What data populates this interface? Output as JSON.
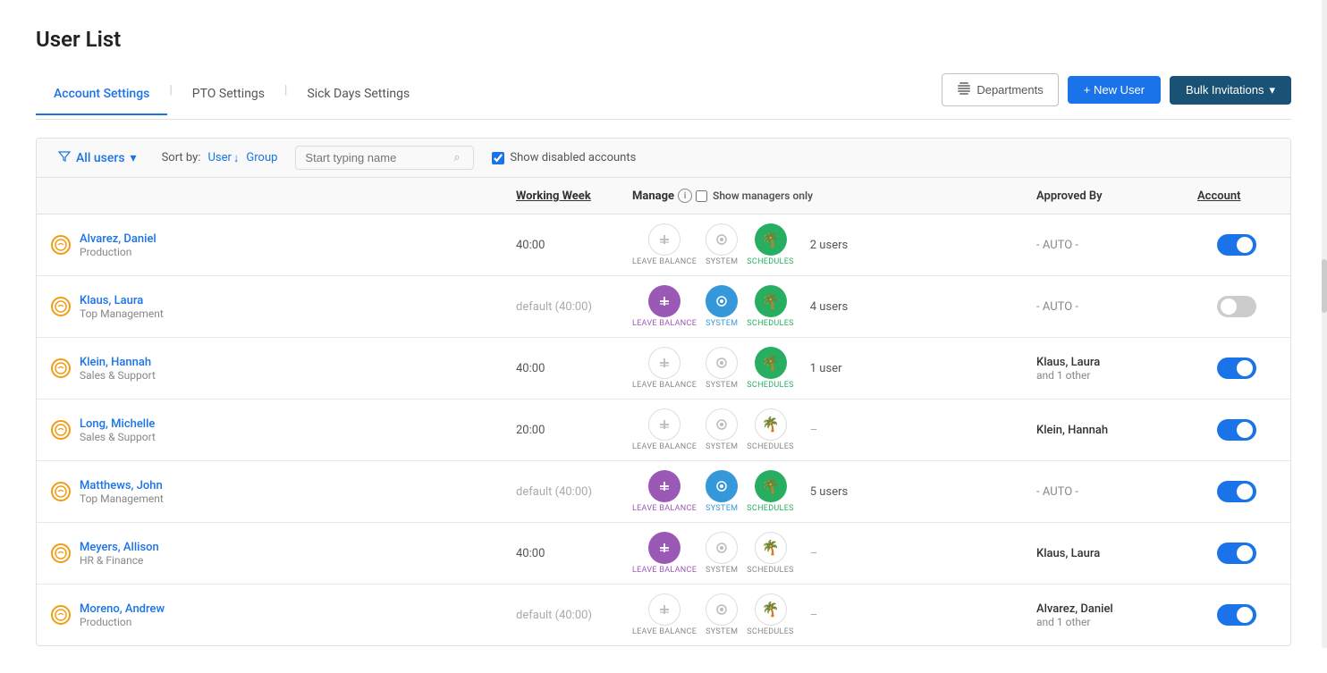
{
  "page": {
    "title": "User List"
  },
  "tabs": [
    {
      "id": "account-settings",
      "label": "Account Settings",
      "active": true
    },
    {
      "id": "pto-settings",
      "label": "PTO Settings",
      "active": false
    },
    {
      "id": "sick-days-settings",
      "label": "Sick Days Settings",
      "active": false
    }
  ],
  "actions": {
    "departments_label": "Departments",
    "new_user_label": "+ New User",
    "bulk_invitations_label": "Bulk Invitations"
  },
  "filter": {
    "all_users_label": "All users",
    "sort_by_label": "Sort by:",
    "sort_user_label": "User",
    "sort_group_label": "Group",
    "search_placeholder": "Start typing name",
    "show_disabled_label": "Show disabled accounts",
    "show_managers_label": "Show managers only"
  },
  "table": {
    "headers": {
      "working_week": "Working Week",
      "manage": "Manage",
      "approved_by": "Approved By",
      "account": "Account"
    },
    "users": [
      {
        "name": "Alvarez, Daniel",
        "department": "Production",
        "working_week": "40:00",
        "working_week_default": false,
        "leave_balance_active": false,
        "system_active": false,
        "schedules_active": true,
        "manage_users": "2 users",
        "approved_by": "- AUTO -",
        "approved_by_sub": "",
        "account_enabled": true
      },
      {
        "name": "Klaus, Laura",
        "department": "Top Management",
        "working_week": "default (40:00)",
        "working_week_default": true,
        "leave_balance_active": true,
        "system_active": true,
        "schedules_active": true,
        "manage_users": "4 users",
        "approved_by": "- AUTO -",
        "approved_by_sub": "",
        "account_enabled": false
      },
      {
        "name": "Klein, Hannah",
        "department": "Sales & Support",
        "working_week": "40:00",
        "working_week_default": false,
        "leave_balance_active": false,
        "system_active": false,
        "schedules_active": true,
        "manage_users": "1 user",
        "approved_by": "Klaus, Laura",
        "approved_by_sub": "and 1 other",
        "account_enabled": true
      },
      {
        "name": "Long, Michelle",
        "department": "Sales & Support",
        "working_week": "20:00",
        "working_week_default": false,
        "leave_balance_active": false,
        "system_active": false,
        "schedules_active": false,
        "manage_users": "–",
        "approved_by": "Klein, Hannah",
        "approved_by_sub": "",
        "account_enabled": true
      },
      {
        "name": "Matthews, John",
        "department": "Top Management",
        "working_week": "default (40:00)",
        "working_week_default": true,
        "leave_balance_active": true,
        "system_active": true,
        "schedules_active": true,
        "manage_users": "5 users",
        "approved_by": "- AUTO -",
        "approved_by_sub": "",
        "account_enabled": true
      },
      {
        "name": "Meyers, Allison",
        "department": "HR & Finance",
        "working_week": "40:00",
        "working_week_default": false,
        "leave_balance_active": true,
        "system_active": false,
        "schedules_active": false,
        "manage_users": "–",
        "approved_by": "Klaus, Laura",
        "approved_by_sub": "",
        "account_enabled": true
      },
      {
        "name": "Moreno, Andrew",
        "department": "Production",
        "working_week": "default (40:00)",
        "working_week_default": true,
        "leave_balance_active": false,
        "system_active": false,
        "schedules_active": false,
        "manage_users": "–",
        "approved_by": "Alvarez, Daniel",
        "approved_by_sub": "and 1 other",
        "account_enabled": true
      }
    ]
  }
}
